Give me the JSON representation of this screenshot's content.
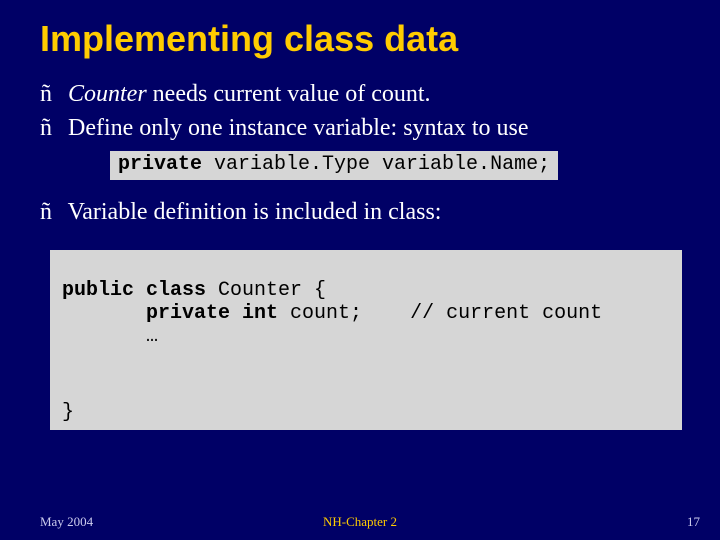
{
  "title": "Implementing class data",
  "bullets": [
    {
      "prefix": "ñ",
      "italic_lead": "Counter",
      "rest": " needs current value of count."
    },
    {
      "prefix": "ñ",
      "italic_lead": "",
      "rest": " Define only one instance variable: syntax to use"
    }
  ],
  "code_syntax": {
    "kw": "private",
    "body": " variable.Type variable.Name;"
  },
  "bullet_after_syntax": {
    "prefix": "ñ",
    "text": " Variable definition is included in class:"
  },
  "code_main": {
    "line1_kw": "public class",
    "line1_rest": " Counter {",
    "line2_indent": "       ",
    "line2_kw": "private int",
    "line2_rest": " count;    // current count",
    "line3": "       …",
    "close": "}"
  },
  "footer": {
    "left": "May 2004",
    "center": "NH-Chapter 2",
    "right": "17"
  }
}
